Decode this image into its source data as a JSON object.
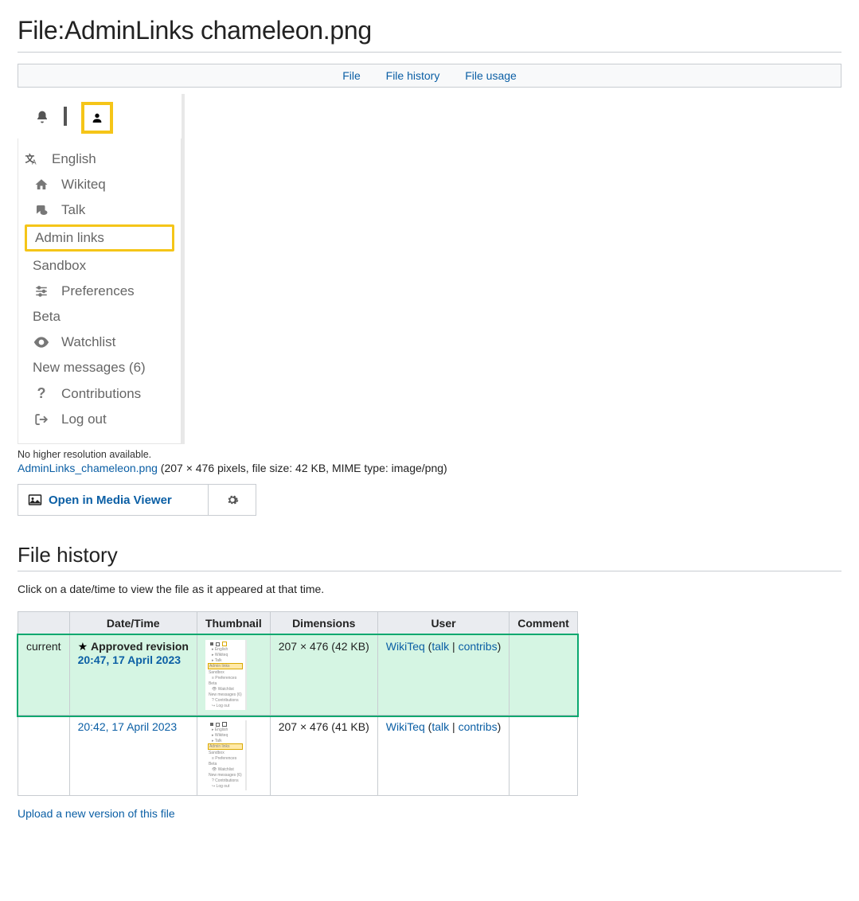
{
  "page_title": "File:AdminLinks chameleon.png",
  "toc": {
    "file": "File",
    "history": "File history",
    "usage": "File usage"
  },
  "preview_menu": {
    "lang": "English",
    "items": [
      {
        "label": "Wikiteq",
        "icon": "home"
      },
      {
        "label": "Talk",
        "icon": "chat"
      }
    ],
    "highlight": "Admin links",
    "items2": [
      {
        "label": "Sandbox",
        "icon": ""
      },
      {
        "label": "Preferences",
        "icon": "sliders"
      },
      {
        "label": "Beta",
        "icon": ""
      },
      {
        "label": "Watchlist",
        "icon": "eye"
      },
      {
        "label": "New messages (6)",
        "icon": ""
      },
      {
        "label": "Contributions",
        "icon": "question"
      },
      {
        "label": "Log out",
        "icon": "signout"
      }
    ]
  },
  "no_higher": "No higher resolution available.",
  "file_link": "AdminLinks_chameleon.png",
  "file_stats": "(207 × 476 pixels, file size: 42 KB, MIME type: image/png)",
  "open_mv": "Open in Media Viewer",
  "history": {
    "heading": "File history",
    "hint": "Click on a date/time to view the file as it appeared at that time.",
    "headers": [
      "",
      "Date/Time",
      "Thumbnail",
      "Dimensions",
      "User",
      "Comment"
    ],
    "rows": [
      {
        "current": "current",
        "approved": "Approved revision",
        "datetime": "20:47, 17 April 2023",
        "dims": "207 × 476 (42 KB)",
        "user": "WikiTeq",
        "talk": "talk",
        "contribs": "contribs"
      },
      {
        "current": "",
        "datetime": "20:42, 17 April 2023",
        "dims": "207 × 476 (41 KB)",
        "user": "WikiTeq",
        "talk": "talk",
        "contribs": "contribs"
      }
    ],
    "upload": "Upload a new version of this file"
  }
}
